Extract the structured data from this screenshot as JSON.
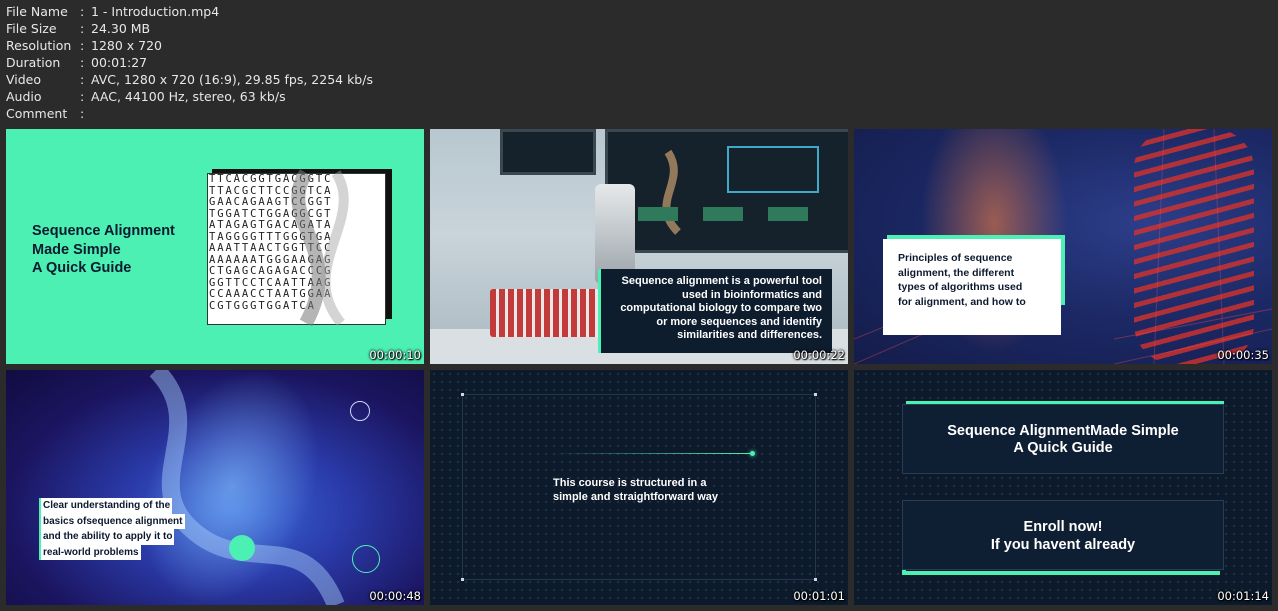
{
  "meta": [
    {
      "key": "File Name",
      "value": "1 - Introduction.mp4"
    },
    {
      "key": "File Size",
      "value": "24.30 MB"
    },
    {
      "key": "Resolution",
      "value": "1280 x 720"
    },
    {
      "key": "Duration",
      "value": "00:01:27"
    },
    {
      "key": "Video",
      "value": "AVC, 1280 x 720 (16:9), 29.85 fps, 2254 kb/s"
    },
    {
      "key": "Audio",
      "value": "AAC, 44100 Hz, stereo, 63 kb/s"
    },
    {
      "key": "Comment",
      "value": ""
    }
  ],
  "separator": ":",
  "thumbs": [
    {
      "timestamp": "00:00:10",
      "title_lines": [
        "Sequence Alignment",
        "Made Simple",
        "A Quick Guide"
      ],
      "dna_lines": [
        "TTCACGGTGACGGTC",
        "TTACGCTTCCGGTCA",
        "GAACAGAAGTCCGGT",
        "TGGATCTGGAGGCGT",
        "ATAGAGTGACAGATA",
        "TAGGGGTTTGGGTGA",
        "AAATTAACTGGTTCC",
        "AAAAAATGGGAAGAG",
        "CTGAGCAGAGACCCG",
        "GGTTCCTCAATTAAG",
        "CCAAACCTAATGGAA",
        "CGTGGGTGGATCA"
      ]
    },
    {
      "timestamp": "00:00:22",
      "caption_lines": [
        "Sequence alignment is a powerful tool",
        "used in bioinformatics and",
        "computational biology to compare two",
        "or more sequences and identify",
        "similarities and differences."
      ]
    },
    {
      "timestamp": "00:00:35",
      "caption_lines": [
        "Principles of sequence",
        "alignment, the different",
        "types of algorithms used",
        "for alignment, and how to"
      ]
    },
    {
      "timestamp": "00:00:48",
      "caption_lines": [
        "Clear understanding of the",
        "basics ofsequence alignment",
        "and the ability to apply it to",
        "real-world problems"
      ]
    },
    {
      "timestamp": "00:01:01",
      "caption_lines": [
        "This course is structured in a",
        "simple and straightforward way"
      ]
    },
    {
      "timestamp": "00:01:14",
      "box1_lines": [
        "Sequence AlignmentMade Simple",
        "A Quick Guide"
      ],
      "box2_lines": [
        "Enroll now!",
        "If you havent already"
      ]
    }
  ],
  "colors": {
    "background": "#2b2b2b",
    "accent_green": "#4cf0b3",
    "navy": "#0c1a2b"
  }
}
